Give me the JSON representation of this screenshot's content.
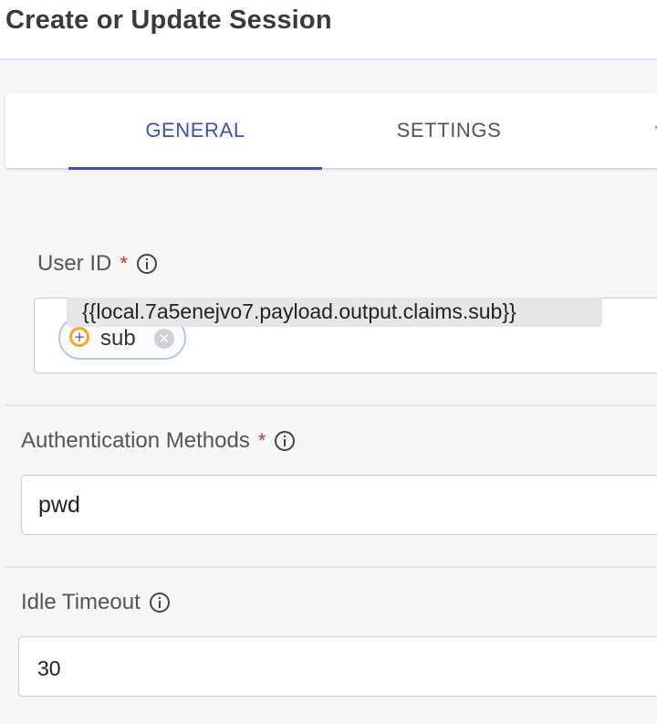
{
  "header": {
    "title": "Create or Update Session"
  },
  "tabs": [
    {
      "label": "GENERAL",
      "active": true
    },
    {
      "label": "SETTINGS",
      "active": false
    }
  ],
  "fields": {
    "user_id": {
      "label": "User ID",
      "required": "*",
      "chip_label": "sub",
      "tooltip": "{{local.7a5enejvo7.payload.output.claims.sub}}"
    },
    "auth_methods": {
      "label": "Authentication Methods",
      "required": "*",
      "value": "pwd"
    },
    "idle_timeout": {
      "label": "Idle Timeout",
      "value": "30"
    }
  },
  "icons": {
    "info": "info-circle-icon",
    "chip_variable": "variable-icon",
    "chip_remove": "close-circle-icon"
  },
  "colors": {
    "accent": "#3f51b5",
    "required": "#d32f2f",
    "chip_icon": "#f5a623"
  }
}
